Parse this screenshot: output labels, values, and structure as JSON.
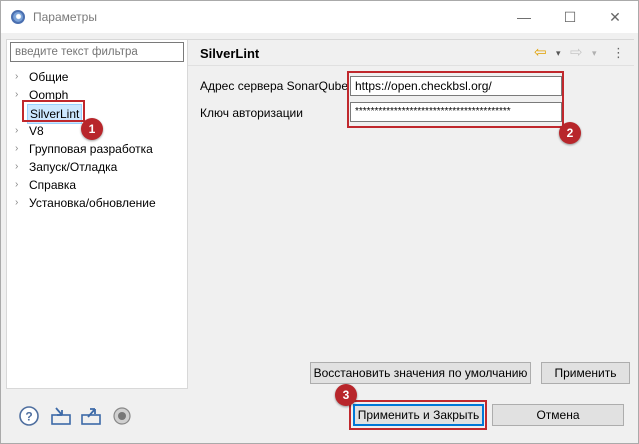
{
  "window": {
    "title": "Параметры",
    "controls": {
      "minimize": "—",
      "maximize": "☐",
      "close": "✕"
    }
  },
  "filter": {
    "placeholder": "введите текст фильтра"
  },
  "tree": {
    "items": [
      {
        "label": "Общие",
        "expandable": true
      },
      {
        "label": "Oomph",
        "expandable": true
      },
      {
        "label": "SilverLint",
        "expandable": false,
        "selected": true
      },
      {
        "label": "V8",
        "expandable": true
      },
      {
        "label": "Групповая разработка",
        "expandable": true
      },
      {
        "label": "Запуск/Отладка",
        "expandable": true
      },
      {
        "label": "Справка",
        "expandable": true
      },
      {
        "label": "Установка/обновление",
        "expandable": true
      }
    ]
  },
  "page": {
    "title": "SilverLint",
    "nav": {
      "back": "⇦",
      "back_dropdown": "▾",
      "forward": "⇨",
      "forward_dropdown": "▾",
      "menu": "⋮"
    },
    "server_label": "Адрес сервера SonarQube",
    "server_value": "https://open.checkbsl.org/",
    "token_label": "Ключ авторизации",
    "token_value": "****************************************",
    "restore_defaults_label": "Восстановить значения по умолчанию",
    "apply_label": "Применить"
  },
  "footer": {
    "apply_close_label": "Применить и Закрыть",
    "cancel_label": "Отмена",
    "icons": [
      "help-icon",
      "import-icon",
      "export-icon",
      "record-icon"
    ]
  },
  "annotations": {
    "badge1": "1",
    "badge2": "2",
    "badge3": "3",
    "color": "#c0282d"
  }
}
